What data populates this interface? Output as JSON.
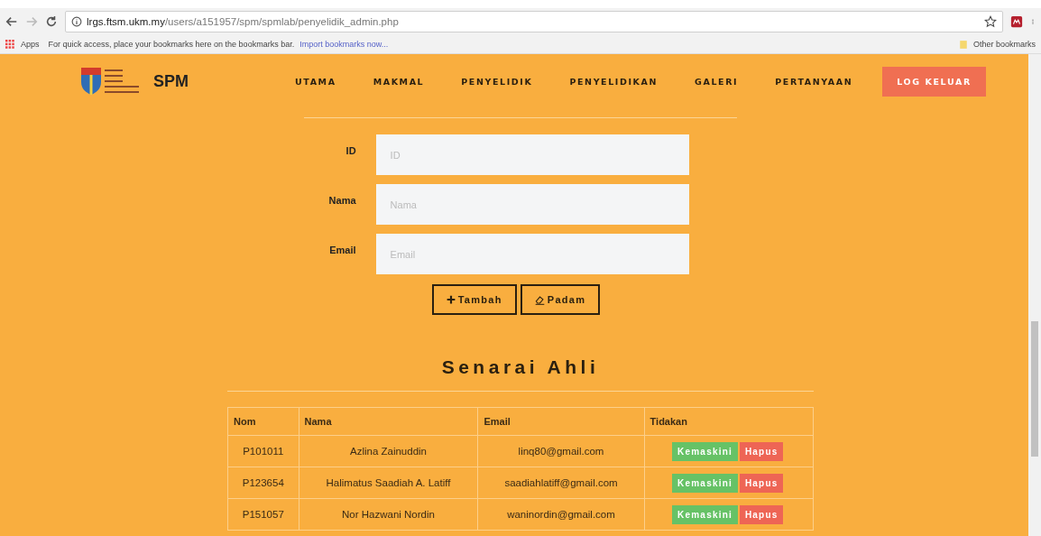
{
  "browser": {
    "url_host": "lrgs.ftsm.ukm.my",
    "url_path": "/users/a151957/spm/spmlab/penyelidik_admin.php",
    "bookmarks_bar": {
      "apps": "Apps",
      "message": "For quick access, place your bookmarks here on the bookmarks bar.",
      "import_link": "Import bookmarks now...",
      "other": "Other bookmarks"
    }
  },
  "header": {
    "brand": "SPM",
    "nav": [
      {
        "label": "UTAMA",
        "kind": "link"
      },
      {
        "label": "MAKMAL",
        "kind": "link"
      },
      {
        "label": "PENYELIDIK",
        "kind": "link"
      },
      {
        "label": "PENYELIDIKAN",
        "kind": "link"
      },
      {
        "label": "GALERI",
        "kind": "link"
      },
      {
        "label": "PERTANYAAN",
        "kind": "link"
      },
      {
        "label": "LOG KELUAR",
        "kind": "button"
      }
    ]
  },
  "form": {
    "fields": [
      {
        "label": "ID",
        "placeholder": "ID"
      },
      {
        "label": "Nama",
        "placeholder": "Nama"
      },
      {
        "label": "Email",
        "placeholder": "Email"
      }
    ],
    "buttons": [
      {
        "label": "Tambah",
        "kind": "add"
      },
      {
        "label": "Padam",
        "kind": "erase"
      }
    ]
  },
  "members": {
    "title": "Senarai Ahli",
    "columns": [
      "Nom",
      "Nama",
      "Email",
      "Tidakan"
    ],
    "rows": [
      {
        "id": "P101011",
        "name": "Azlina Zainuddin",
        "email": "linq80@gmail.com",
        "actions": [
          "Kemaskini",
          "Hapus"
        ]
      },
      {
        "id": "P123654",
        "name": "Halimatus Saadiah A. Latiff",
        "email": "saadiahlatiff@gmail.com",
        "actions": [
          "Kemaskini",
          "Hapus"
        ]
      },
      {
        "id": "P151057",
        "name": "Nor Hazwani Nordin",
        "email": "waninordin@gmail.com",
        "actions": [
          "Kemaskini",
          "Hapus"
        ]
      }
    ]
  }
}
